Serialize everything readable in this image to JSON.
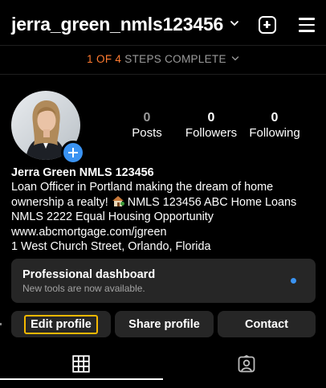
{
  "header": {
    "username": "jerra_green_nmls123456",
    "icons": [
      "chevron-down-icon",
      "new-post-icon",
      "menu-icon"
    ]
  },
  "steps": {
    "progress": "1 OF 4",
    "text": "STEPS COMPLETE"
  },
  "stats": [
    {
      "value": "0",
      "label": "Posts"
    },
    {
      "value": "0",
      "label": "Followers"
    },
    {
      "value": "0",
      "label": "Following"
    }
  ],
  "bio": {
    "name": "Jerra Green NMLS 123456",
    "line1": "Loan Officer in Portland making the dream of home",
    "line2_pre": "ownership a realty!",
    "line2_post": "NMLS 123456 ABC Home Loans",
    "line3": "NMLS 2222 Equal Housing Opportunity",
    "link": "www.abcmortgage.com/jgreen",
    "address": "1 West Church Street, Orlando, Florida"
  },
  "dashboard": {
    "title": "Professional dashboard",
    "subtitle": "New tools are now available."
  },
  "buttons": {
    "edit": "Edit profile",
    "share": "Share profile",
    "contact": "Contact"
  },
  "tabs": [
    "grid-icon",
    "tagged-icon"
  ],
  "colors": {
    "accent_orange": "#ff7a30",
    "blue": "#3a93f2",
    "highlight": "#f5b800",
    "card": "#262626"
  }
}
